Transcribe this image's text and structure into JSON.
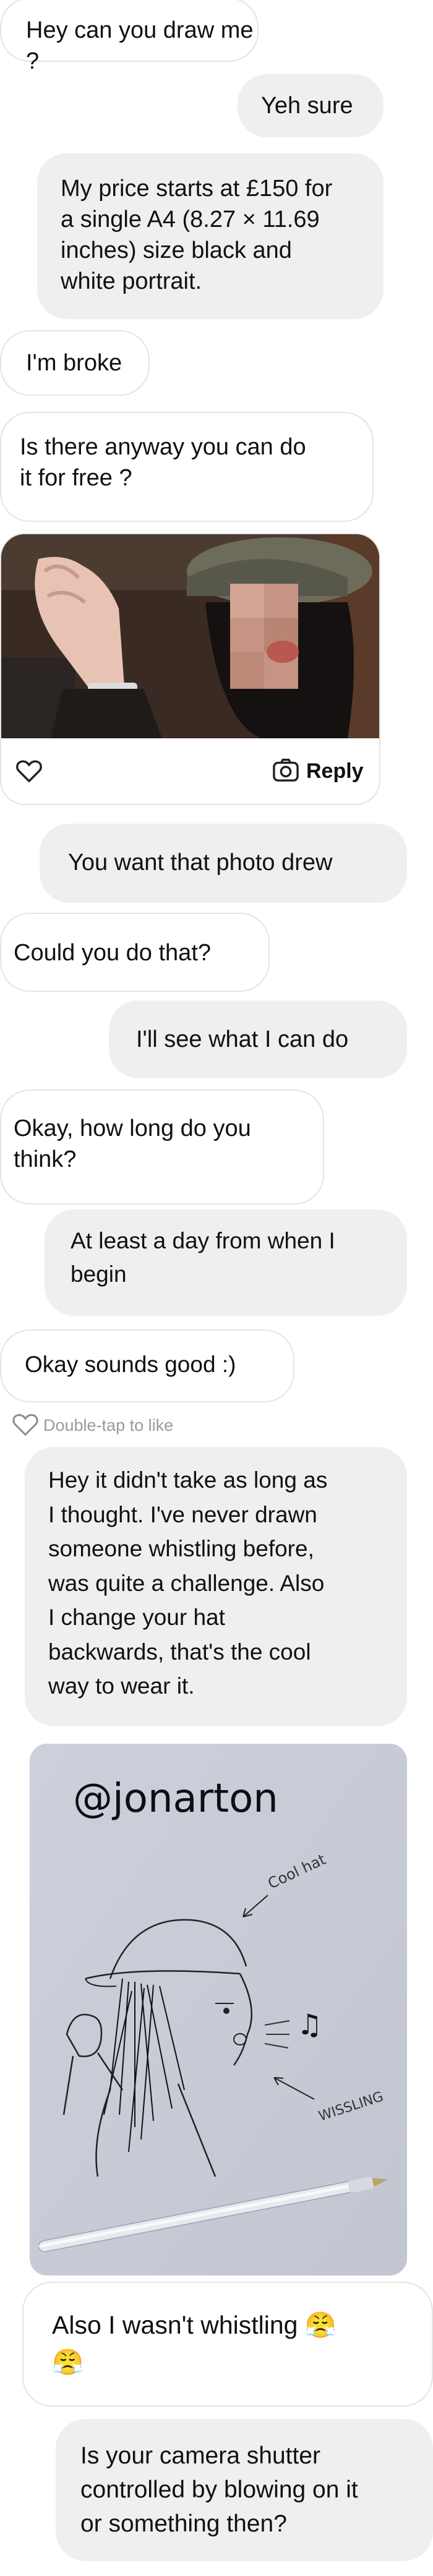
{
  "messages": [
    {
      "id": "m1",
      "side": "in",
      "text": "Hey can you draw me ?"
    },
    {
      "id": "m2",
      "side": "out",
      "text": "Yeh sure"
    },
    {
      "id": "m3",
      "side": "out",
      "text": "My price starts at £150 for\na single A4 (8.27 × 11.69\ninches) size black and\nwhite portrait."
    },
    {
      "id": "m4",
      "side": "in",
      "text": "I'm broke"
    },
    {
      "id": "m5",
      "side": "in",
      "text": "Is there anyway you can do\nit for free ?"
    },
    {
      "id": "m6",
      "side": "out",
      "text": "You want that photo drew"
    },
    {
      "id": "m7",
      "side": "in",
      "text": "Could you do that?"
    },
    {
      "id": "m8",
      "side": "out",
      "text": "I'll see what I can do"
    },
    {
      "id": "m9",
      "side": "in",
      "text": "Okay, how long do you\nthink?"
    },
    {
      "id": "m10",
      "side": "out",
      "text": "At least a day from when I\nbegin"
    },
    {
      "id": "m11",
      "side": "in",
      "text": "Okay sounds good :)"
    },
    {
      "id": "m12",
      "side": "out",
      "text": "Hey it didn't take as long as\nI thought. I've never drawn\nsomeone whistling before,\nwas quite a challenge. Also\nI change your hat\nbackwards, that's the cool\nway to wear it."
    },
    {
      "id": "m13",
      "side": "in",
      "text": "Also I wasn't whistling 😤\n😤"
    },
    {
      "id": "m14",
      "side": "out",
      "text": "Is your camera shutter\ncontrolled by blowing on it\nor something then?"
    }
  ],
  "photo_message": {
    "reply_label": "Reply",
    "icons": {
      "like": "heart-icon",
      "reply": "camera-icon"
    }
  },
  "reaction_hint": {
    "text": "Double-tap to like",
    "icon": "heart-icon"
  },
  "drawing": {
    "watermark": "@jonarton",
    "annotations": {
      "hat": "Cool hat",
      "whistle": "WISSLING"
    }
  },
  "colors": {
    "incoming_bg": "#ffffff",
    "outgoing_bg": "#efefef",
    "border": "#e4e4e4",
    "hint": "#9a9a9a"
  }
}
